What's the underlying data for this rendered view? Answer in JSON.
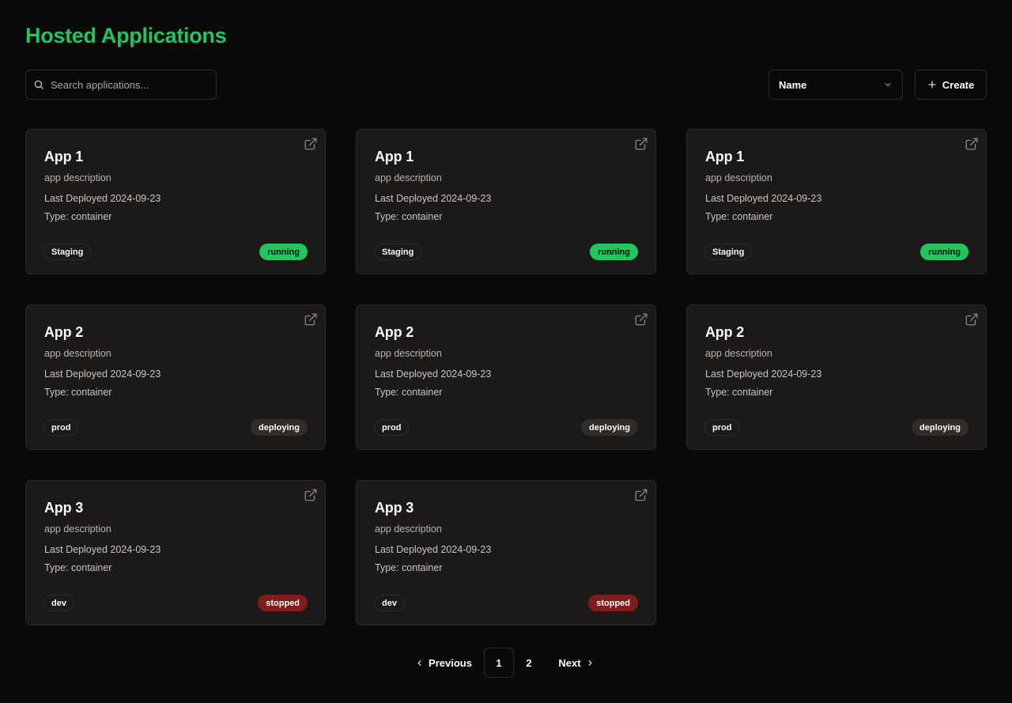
{
  "page": {
    "title": "Hosted Applications"
  },
  "toolbar": {
    "search_placeholder": "Search applications...",
    "sort_value": "Name",
    "create_label": "Create"
  },
  "apps": [
    {
      "name": "App 1",
      "description": "app description",
      "last_deployed": "Last Deployed 2024-09-23",
      "type": "Type: container",
      "env": "Staging",
      "status": "running"
    },
    {
      "name": "App 1",
      "description": "app description",
      "last_deployed": "Last Deployed 2024-09-23",
      "type": "Type: container",
      "env": "Staging",
      "status": "running"
    },
    {
      "name": "App 1",
      "description": "app description",
      "last_deployed": "Last Deployed 2024-09-23",
      "type": "Type: container",
      "env": "Staging",
      "status": "running"
    },
    {
      "name": "App 2",
      "description": "app description",
      "last_deployed": "Last Deployed 2024-09-23",
      "type": "Type: container",
      "env": "prod",
      "status": "deploying"
    },
    {
      "name": "App 2",
      "description": "app description",
      "last_deployed": "Last Deployed 2024-09-23",
      "type": "Type: container",
      "env": "prod",
      "status": "deploying"
    },
    {
      "name": "App 2",
      "description": "app description",
      "last_deployed": "Last Deployed 2024-09-23",
      "type": "Type: container",
      "env": "prod",
      "status": "deploying"
    },
    {
      "name": "App 3",
      "description": "app description",
      "last_deployed": "Last Deployed 2024-09-23",
      "type": "Type: container",
      "env": "dev",
      "status": "stopped"
    },
    {
      "name": "App 3",
      "description": "app description",
      "last_deployed": "Last Deployed 2024-09-23",
      "type": "Type: container",
      "env": "dev",
      "status": "stopped"
    }
  ],
  "pagination": {
    "previous_label": "Previous",
    "pages": [
      "1",
      "2"
    ],
    "current": "1",
    "next_label": "Next"
  },
  "icons": {
    "search": "search-icon",
    "sort_toggle": "chevron-down-icon",
    "create": "plus-icon",
    "card_link": "external-link-icon",
    "previous": "chevron-left-icon",
    "next": "chevron-right-icon"
  },
  "colors": {
    "accent": "#22c55e",
    "background": "#0c0a09",
    "card": "#1c1a19",
    "running": "#22c55e",
    "deploying": "#2f2c2a",
    "stopped": "#7f1d1d"
  }
}
